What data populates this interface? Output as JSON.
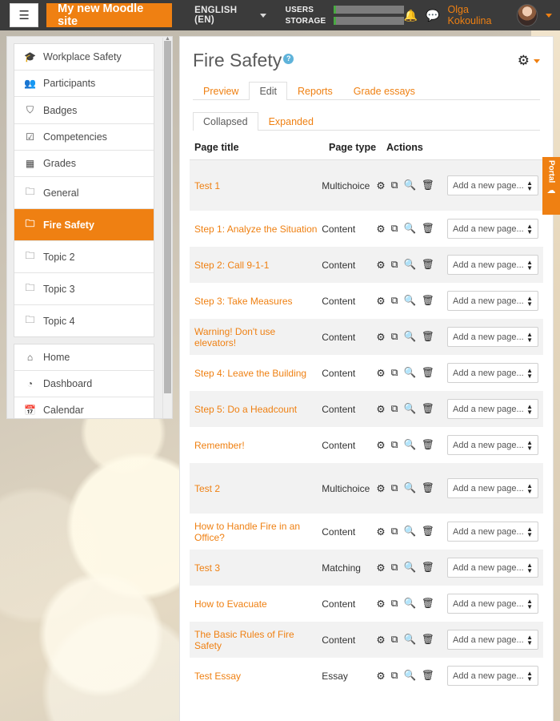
{
  "navbar": {
    "menu_icon": "hamburger-icon",
    "site_name": "My new Moodle site",
    "language": "ENGLISH (EN)",
    "meters": [
      {
        "label": "USERS",
        "fill_percent": 4
      },
      {
        "label": "STORAGE",
        "fill_percent": 4
      }
    ],
    "notifications_icon": "bell-icon",
    "messages_icon": "chat-icon",
    "username": "Olga Kokoulina",
    "avatar": "user-avatar"
  },
  "sidebar": {
    "group1": [
      {
        "label": "Workplace Safety",
        "icon": "graduation-cap-icon",
        "active": false
      },
      {
        "label": "Participants",
        "icon": "users-icon",
        "active": false
      },
      {
        "label": "Badges",
        "icon": "shield-icon",
        "active": false
      },
      {
        "label": "Competencies",
        "icon": "check-square-icon",
        "active": false
      },
      {
        "label": "Grades",
        "icon": "table-icon",
        "active": false
      },
      {
        "label": "General",
        "icon": "folder-icon",
        "active": false
      },
      {
        "label": "Fire Safety",
        "icon": "folder-icon",
        "active": true
      },
      {
        "label": "Topic 2",
        "icon": "folder-icon",
        "active": false
      },
      {
        "label": "Topic 3",
        "icon": "folder-icon",
        "active": false
      },
      {
        "label": "Topic 4",
        "icon": "folder-icon",
        "active": false
      }
    ],
    "group2": [
      {
        "label": "Home",
        "icon": "home-icon",
        "active": false
      },
      {
        "label": "Dashboard",
        "icon": "dashboard-icon",
        "active": false
      },
      {
        "label": "Calendar",
        "icon": "calendar-icon",
        "active": false
      }
    ]
  },
  "main": {
    "title": "Fire Safety",
    "help_icon": "help-circle-icon",
    "settings_icon": "gear-icon",
    "tabs": [
      {
        "label": "Preview",
        "active": false
      },
      {
        "label": "Edit",
        "active": true
      },
      {
        "label": "Reports",
        "active": false
      },
      {
        "label": "Grade essays",
        "active": false
      }
    ],
    "subtabs": [
      {
        "label": "Collapsed",
        "active": true
      },
      {
        "label": "Expanded",
        "active": false
      }
    ],
    "table": {
      "columns": [
        "Page title",
        "Page type",
        "Actions"
      ],
      "action_icons": [
        "gear-icon",
        "copy-icon",
        "preview-icon",
        "delete-icon"
      ],
      "select_label": "Add a new page...",
      "rows": [
        {
          "title": "Test 1",
          "type": "Multichoice",
          "tall": true
        },
        {
          "title": "Step 1: Analyze the Situation",
          "type": "Content",
          "tall": false
        },
        {
          "title": "Step 2: Call 9-1-1",
          "type": "Content",
          "tall": false
        },
        {
          "title": "Step 3: Take Measures",
          "type": "Content",
          "tall": false
        },
        {
          "title": "Warning! Don't use elevators!",
          "type": "Content",
          "tall": false
        },
        {
          "title": "Step 4: Leave the Building",
          "type": "Content",
          "tall": false
        },
        {
          "title": "Step 5: Do a Headcount",
          "type": "Content",
          "tall": false
        },
        {
          "title": "Remember!",
          "type": "Content",
          "tall": false
        },
        {
          "title": "Test 2",
          "type": "Multichoice",
          "tall": true
        },
        {
          "title": "How to Handle Fire in an Office?",
          "type": "Content",
          "tall": false
        },
        {
          "title": "Test 3",
          "type": "Matching",
          "tall": false
        },
        {
          "title": "How to Evacuate",
          "type": "Content",
          "tall": false
        },
        {
          "title": "The Basic Rules of Fire Safety",
          "type": "Content",
          "tall": false
        },
        {
          "title": "Test Essay",
          "type": "Essay",
          "tall": false
        }
      ]
    }
  },
  "portal": {
    "label": "Portal",
    "icon": "cloud-icon"
  },
  "colors": {
    "accent": "#ef8012",
    "navbar_bg": "#3b3b3b",
    "meter_fill": "#49a942",
    "help_blue": "#5fb3da"
  }
}
